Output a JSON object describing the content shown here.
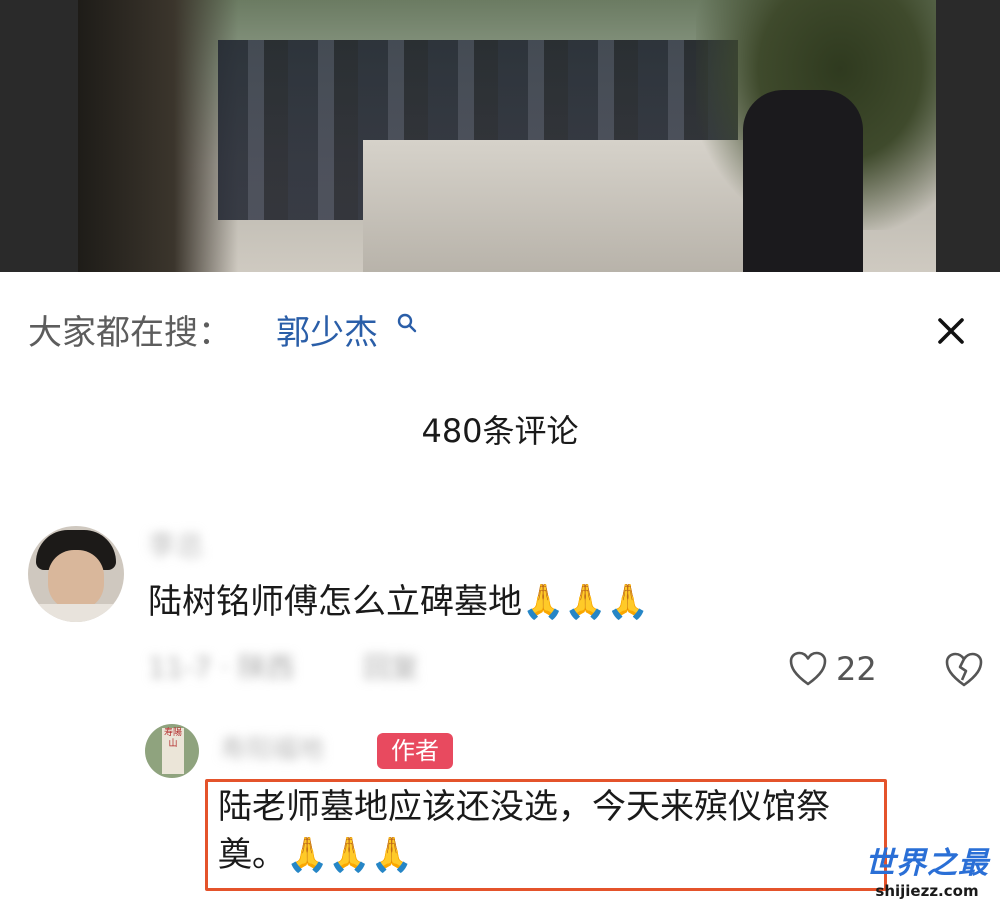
{
  "search_bar": {
    "label": "大家都在搜：",
    "term": "郭少杰"
  },
  "comments_header": {
    "count_text": "480条评论"
  },
  "comments": [
    {
      "username": "李总",
      "text": "陆树铭师傅怎么立碑墓地🙏🙏🙏",
      "date_location": "11-7 · 陕西",
      "reply_label": "回复",
      "like_count": "22"
    }
  ],
  "author_reply": {
    "username": "寿阳福地",
    "badge": "作者",
    "text": "陆老师墓地应该还没选，今天来殡仪馆祭奠。🙏🙏🙏",
    "avatar_text": "寿陽山"
  },
  "watermark": {
    "title": "世界之最",
    "url": "shijiezz.com"
  },
  "colors": {
    "search_term": "#2a5ea8",
    "author_badge": "#e84a5f",
    "highlight_border": "#e4532b",
    "watermark": "#2a6fd6"
  },
  "icons": {
    "search": "search-icon",
    "close": "close-icon",
    "like": "heart-icon",
    "dislike": "broken-heart-icon"
  }
}
